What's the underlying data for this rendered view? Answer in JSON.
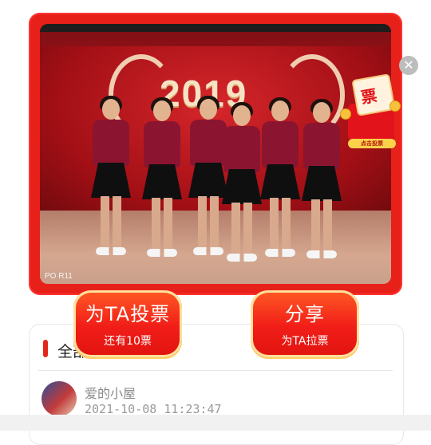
{
  "photo": {
    "year_text": "2019",
    "watermark": "PO R11"
  },
  "gift": {
    "ticket_char": "票",
    "pill_label": "点击投票"
  },
  "actions": {
    "vote": {
      "label": "为TA投票",
      "sub": "还有10票"
    },
    "share": {
      "label": "分享",
      "sub": "为TA拉票"
    }
  },
  "section": {
    "title": "全部"
  },
  "entry": {
    "name": "爱的小屋",
    "time": "2021-10-08 11:23:47"
  },
  "colors": {
    "accent": "#e2261b",
    "frame_red": "#e8201a"
  }
}
